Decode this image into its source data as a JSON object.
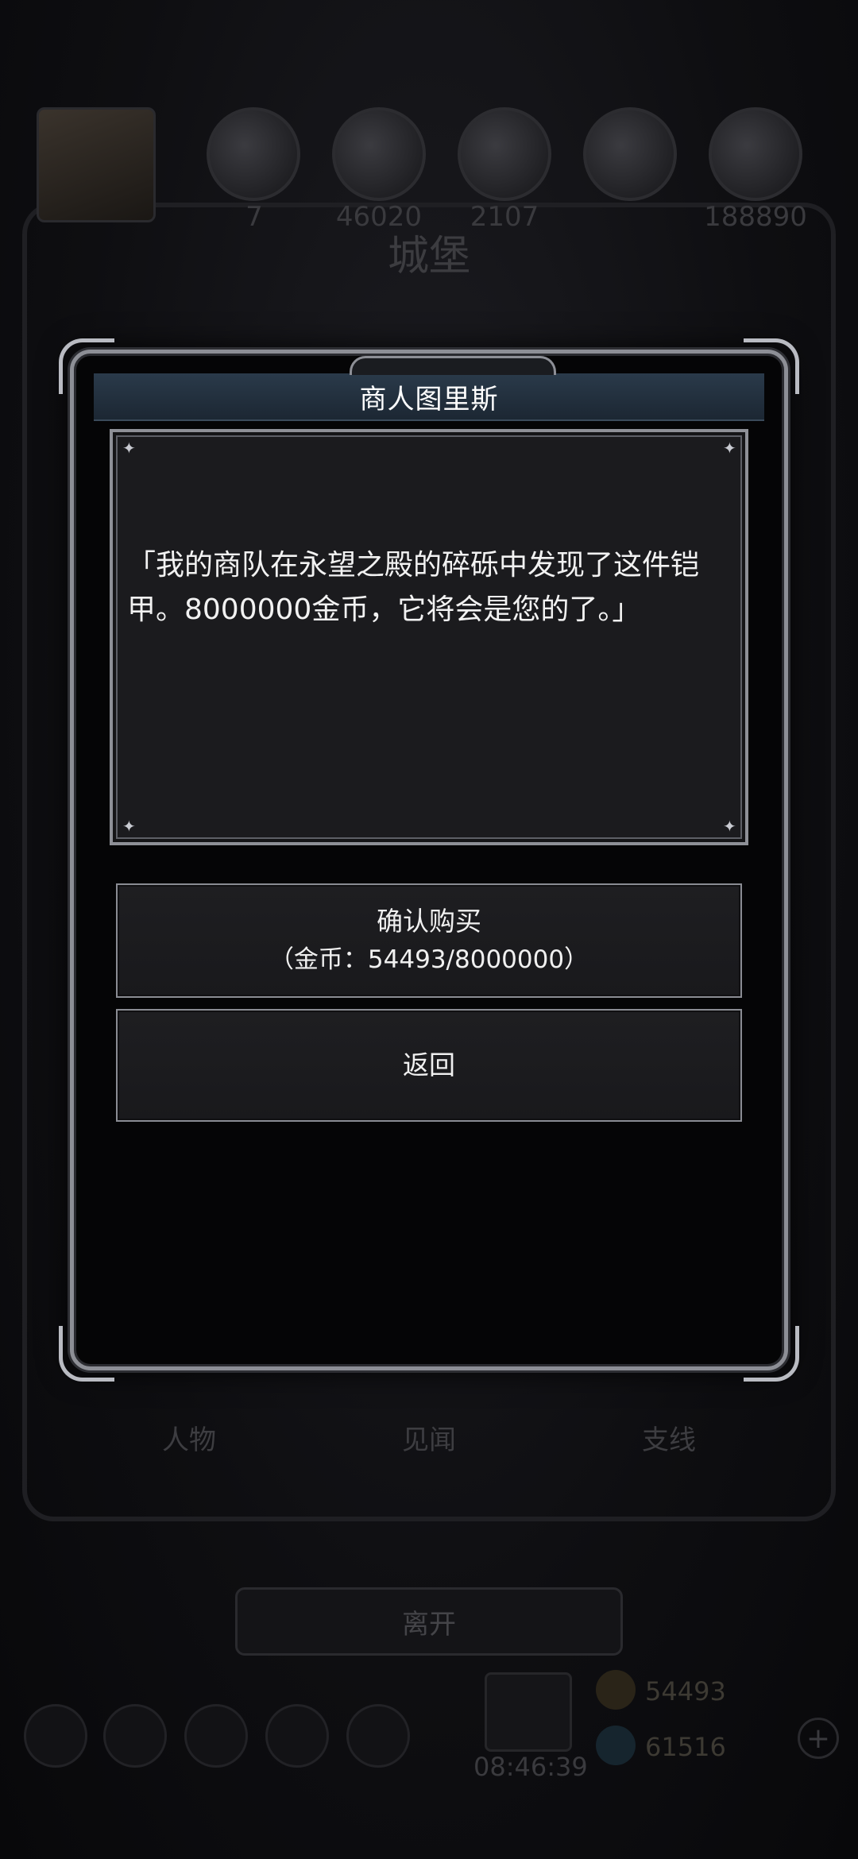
{
  "background": {
    "title": "城堡",
    "resources": [
      {
        "icon": "portrait",
        "value": ""
      },
      {
        "icon": "resource-icon-1",
        "value": "7"
      },
      {
        "icon": "resource-icon-2",
        "value": "46020"
      },
      {
        "icon": "resource-icon-3",
        "value": "2107"
      },
      {
        "icon": "resource-icon-4",
        "value": ""
      },
      {
        "icon": "resource-icon-5",
        "value": "188890"
      }
    ],
    "tabs": [
      "人物",
      "见闻",
      "支线"
    ],
    "leave_label": "离开",
    "clock": "08:46:39",
    "gold_value": "54493",
    "gem_value": "61516"
  },
  "dialog": {
    "title": "商人图里斯",
    "message": "「我的商队在永望之殿的碎砾中发现了这件铠甲。8000000金币，它将会是您的了。」",
    "confirm_label": "确认购买",
    "confirm_cost": "（金币：54493/8000000）",
    "back_label": "返回"
  },
  "currency": {
    "gold_owned": 54493,
    "price": 8000000
  }
}
